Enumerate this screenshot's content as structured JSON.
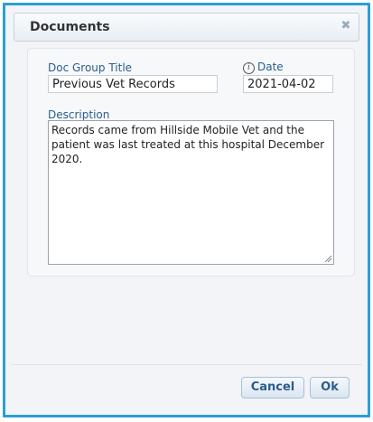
{
  "dialog": {
    "title": "Documents",
    "close_icon": "close-icon",
    "close_glyph": "✖"
  },
  "form": {
    "doc_group_title_label": "Doc Group Title",
    "doc_group_title_value": "Previous Vet Records",
    "date_label": "Date",
    "date_info_icon": "info-icon",
    "date_value": "2021-04-02",
    "description_label": "Description",
    "description_value": "Records came from Hillside Mobile Vet and the patient was last treated at this hospital December 2020."
  },
  "buttons": {
    "cancel": "Cancel",
    "ok": "Ok"
  },
  "colors": {
    "border_accent": "#2a9fd6",
    "label": "#2c5d8c"
  }
}
